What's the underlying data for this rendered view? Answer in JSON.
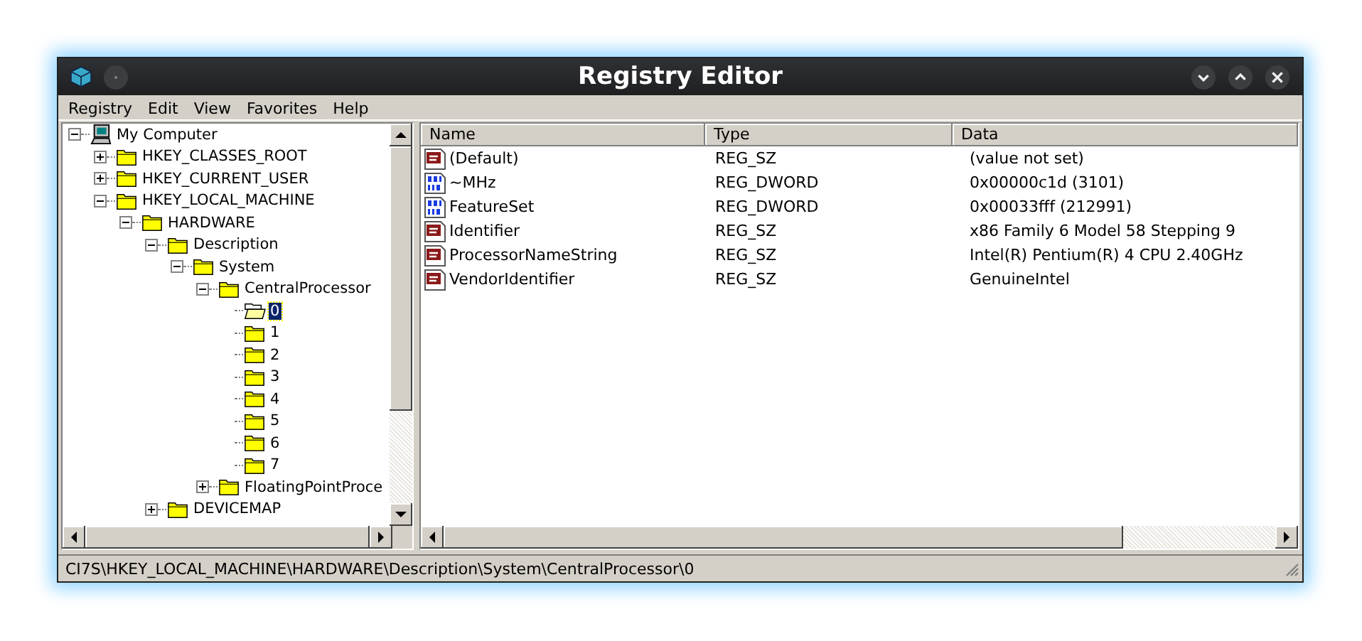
{
  "window": {
    "title": "Registry Editor"
  },
  "menu": [
    "Registry",
    "Edit",
    "View",
    "Favorites",
    "Help"
  ],
  "tree": [
    {
      "label": "My Computer",
      "kind": "computer",
      "expanded": true,
      "selected": false,
      "children": [
        {
          "label": "HKEY_CLASSES_ROOT",
          "kind": "folder",
          "expanded": false,
          "selected": false
        },
        {
          "label": "HKEY_CURRENT_USER",
          "kind": "folder",
          "expanded": false,
          "selected": false
        },
        {
          "label": "HKEY_LOCAL_MACHINE",
          "kind": "folder",
          "expanded": true,
          "selected": false,
          "children": [
            {
              "label": "HARDWARE",
              "kind": "folder",
              "expanded": true,
              "selected": false,
              "children": [
                {
                  "label": "Description",
                  "kind": "folder",
                  "expanded": true,
                  "selected": false,
                  "children": [
                    {
                      "label": "System",
                      "kind": "folder",
                      "expanded": true,
                      "selected": false,
                      "children": [
                        {
                          "label": "CentralProcessor",
                          "kind": "folder",
                          "expanded": true,
                          "selected": false,
                          "children": [
                            {
                              "label": "0",
                              "kind": "folder",
                              "selected": true
                            },
                            {
                              "label": "1",
                              "kind": "folder",
                              "selected": false
                            },
                            {
                              "label": "2",
                              "kind": "folder",
                              "selected": false
                            },
                            {
                              "label": "3",
                              "kind": "folder",
                              "selected": false
                            },
                            {
                              "label": "4",
                              "kind": "folder",
                              "selected": false
                            },
                            {
                              "label": "5",
                              "kind": "folder",
                              "selected": false
                            },
                            {
                              "label": "6",
                              "kind": "folder",
                              "selected": false
                            },
                            {
                              "label": "7",
                              "kind": "folder",
                              "selected": false
                            }
                          ]
                        },
                        {
                          "label": "FloatingPointProce",
                          "kind": "folder",
                          "expanded": false,
                          "selected": false
                        }
                      ]
                    }
                  ]
                },
                {
                  "label": "DEVICEMAP",
                  "kind": "folder",
                  "expanded": false,
                  "selected": false
                }
              ]
            }
          ]
        }
      ]
    }
  ],
  "values": {
    "columns": [
      "Name",
      "Type",
      "Data"
    ],
    "rows": [
      {
        "kind": "string",
        "name": "(Default)",
        "type": "REG_SZ",
        "data": "(value not set)"
      },
      {
        "kind": "dword",
        "name": "~MHz",
        "type": "REG_DWORD",
        "data": "0x00000c1d (3101)"
      },
      {
        "kind": "dword",
        "name": "FeatureSet",
        "type": "REG_DWORD",
        "data": "0x00033fff (212991)"
      },
      {
        "kind": "string",
        "name": "Identifier",
        "type": "REG_SZ",
        "data": "x86 Family 6 Model 58 Stepping 9"
      },
      {
        "kind": "string",
        "name": "ProcessorNameString",
        "type": "REG_SZ",
        "data": "Intel(R) Pentium(R) 4 CPU 2.40GHz"
      },
      {
        "kind": "string",
        "name": "VendorIdentifier",
        "type": "REG_SZ",
        "data": "GenuineIntel"
      }
    ]
  },
  "status_bar": "CI7S\\HKEY_LOCAL_MACHINE\\HARDWARE\\Description\\System\\CentralProcessor\\0"
}
